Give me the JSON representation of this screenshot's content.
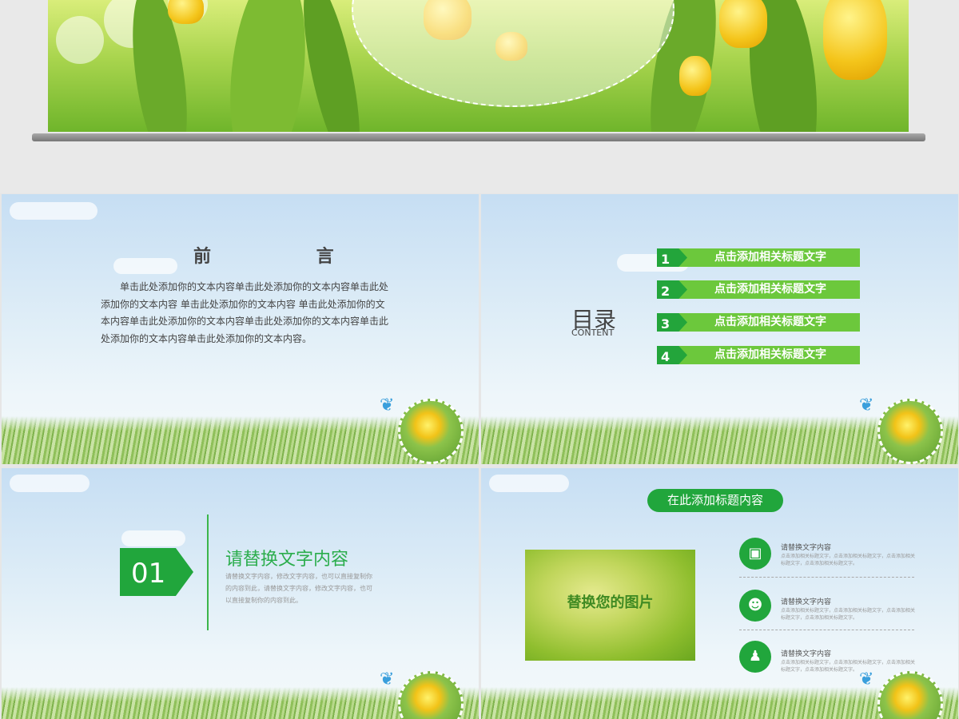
{
  "preface": {
    "title": "前 言",
    "body": "单击此处添加你的文本内容单击此处添加你的文本内容单击此处添加你的文本内容 单击此处添加你的文本内容 单击此处添加你的文本内容单击此处添加你的文本内容单击此处添加你的文本内容单击此处添加你的文本内容单击此处添加你的文本内容。"
  },
  "toc": {
    "title": "目录",
    "subtitle": "CONTENT",
    "items": [
      {
        "num": "1",
        "label": "点击添加相关标题文字"
      },
      {
        "num": "2",
        "label": "点击添加相关标题文字"
      },
      {
        "num": "3",
        "label": "点击添加相关标题文字"
      },
      {
        "num": "4",
        "label": "点击添加相关标题文字"
      }
    ]
  },
  "section": {
    "number": "01",
    "title": "请替换文字内容",
    "body": "请替换文字内容，修改文字内容，也可以直接复制你的内容到此，请替换文字内容，修改文字内容，也可以直接复制你的内容到此。"
  },
  "content": {
    "pill": "在此添加标题内容",
    "image_label": "替换您的图片",
    "features": [
      {
        "icon": "presentation-icon",
        "title": "请替换文字内容",
        "desc": "点击添加相关标题文字，点击添加相关标题文字，点击添加相关标题文字，点击添加相关标题文字。"
      },
      {
        "icon": "lightbulb-head-icon",
        "title": "请替换文字内容",
        "desc": "点击添加相关标题文字，点击添加相关标题文字，点击添加相关标题文字，点击添加相关标题文字。"
      },
      {
        "icon": "team-icon",
        "title": "请替换文字内容",
        "desc": "点击添加相关标题文字，点击添加相关标题文字，点击添加相关标题文字，点击添加相关标题文字。"
      }
    ]
  },
  "colors": {
    "accent": "#21a63c",
    "light_accent": "#6cc83c",
    "sky": "#c6def3"
  }
}
